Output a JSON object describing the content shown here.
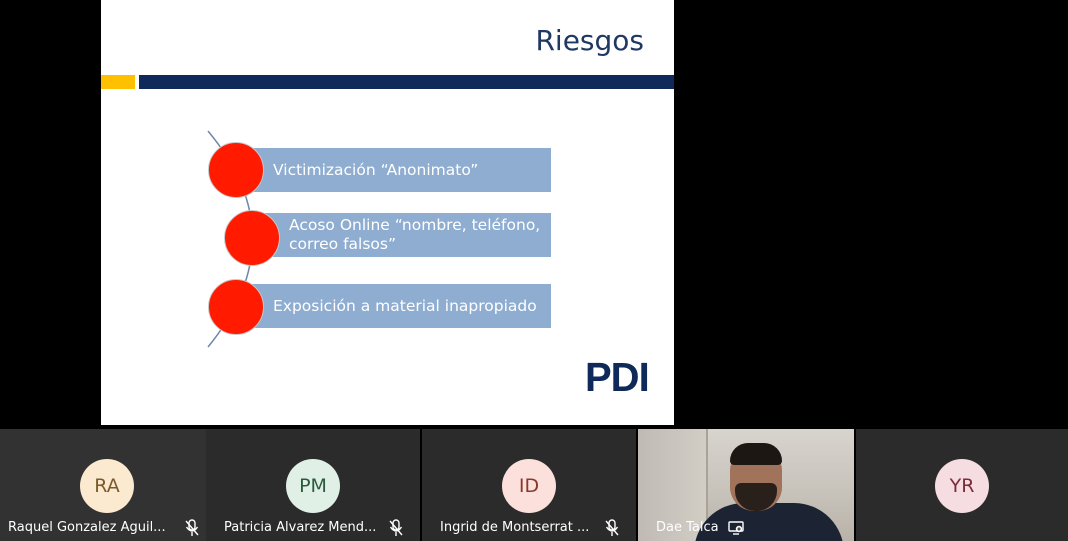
{
  "slide": {
    "title": "Riesgos",
    "items": [
      "Victimización “Anonimato”",
      "Acoso Online “nombre, teléfono, correo falsos”",
      "Exposición a material inapropiado"
    ],
    "logo": "PDI",
    "colors": {
      "accent_yellow": "#ffc000",
      "navy": "#0f2a5a",
      "item_fill": "#8eadd0",
      "dot_red": "#ff1a00"
    }
  },
  "participants": [
    {
      "initials": "RA",
      "name": "Raquel Gonzalez Aguil...",
      "avatar_bg": "#fbe9d0",
      "avatar_fg": "#7a5a2c",
      "muted": true
    },
    {
      "initials": "PM",
      "name": "Patricia Alvarez Mend...",
      "avatar_bg": "#e0f0e6",
      "avatar_fg": "#2c5a3e",
      "muted": true
    },
    {
      "initials": "ID",
      "name": "Ingrid de Montserrat ...",
      "avatar_bg": "#fbe0dc",
      "avatar_fg": "#8a3a2c",
      "muted": true
    },
    {
      "name": "Dae Talca",
      "video": true,
      "icon": "screen-share-icon"
    },
    {
      "initials": "YR",
      "name": "",
      "avatar_bg": "#f5dde2",
      "avatar_fg": "#7a2c3a"
    }
  ]
}
